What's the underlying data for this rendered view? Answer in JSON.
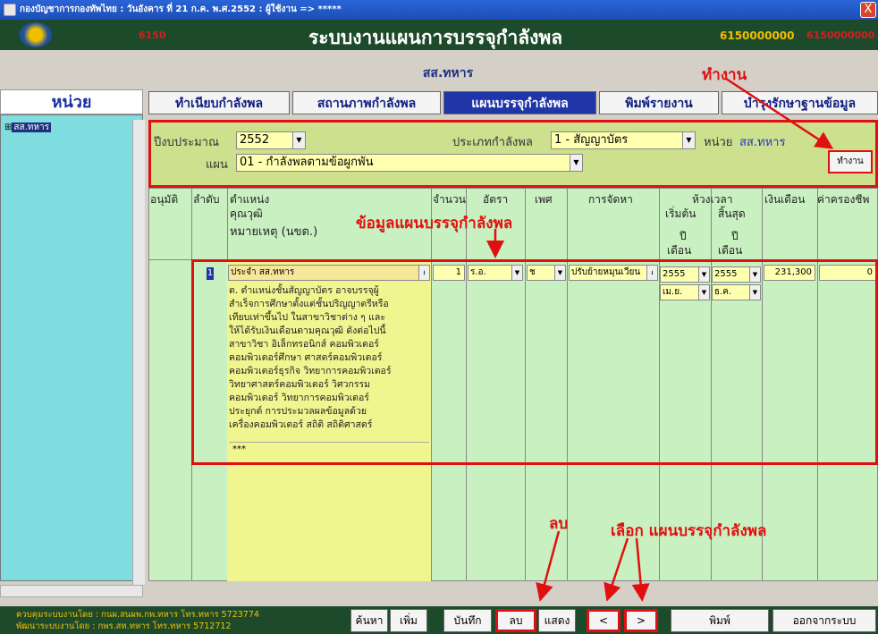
{
  "window": {
    "title": "กองบัญชาการกองทัพไทย : วันอังคาร ที่ 21 ก.ค. พ.ศ.2552 : ผู้ใช้งาน => *****",
    "close_label": "X"
  },
  "banner": {
    "code": "6150",
    "title": "ระบบงานแผนการบรรจุกำลังพล",
    "code1": "6150000000",
    "code2": "6150000000"
  },
  "unit_name": "สส.ทหาร",
  "annotations": {
    "work": "ทำงาน",
    "data": "ข้อมูลแผนบรรจุกำลังพล",
    "delete": "ลบ",
    "select": "เลือก แผนบรรจุกำลังพล"
  },
  "sidebar": {
    "header": "หน่วย",
    "tree_item": "สส.ทหาร"
  },
  "tabs": [
    {
      "label": "ทำเนียบกำลังพล"
    },
    {
      "label": "สถานภาพกำลังพล"
    },
    {
      "label": "แผนบรรจุกำลังพล"
    },
    {
      "label": "พิมพ์รายงาน"
    },
    {
      "label": "บำรุงรักษาฐานข้อมูล"
    }
  ],
  "form": {
    "year_label": "ปีงบประมาณ",
    "year_value": "2552",
    "type_label": "ประเภทกำลังพล",
    "type_value": "1 - สัญญาบัตร",
    "unit_label": "หน่วย",
    "unit_value": "สส.ทหาร",
    "plan_label": "แผน",
    "plan_value": "01 - กำลังพลตามข้อผูกพัน",
    "work_button": "ทำงาน"
  },
  "columns": {
    "approve": "อนุมัติ",
    "order": "ลำดับ",
    "position": "ตำแหน่ง",
    "qualification": "คุณวุฒิ",
    "remark": "หมายเหตุ (นขต.)",
    "count": "จำนวน",
    "rate": "อัตรา",
    "sex": "เพศ",
    "procure": "การจัดหา",
    "period": "ห้วงเวลา",
    "start": "เริ่มต้น",
    "end": "สิ้นสุด",
    "year": "ปี",
    "month": "เดือน",
    "salary": "เงินเดือน",
    "allowance": "ค่าครองชีพ"
  },
  "row": {
    "order": "1",
    "position": "ประจำ สส.ทหาร",
    "count": "1",
    "rate": "ร.อ.",
    "sex": "ช",
    "procure": "ปรับย้ายหมุนเวียน",
    "start_year": "2555",
    "start_month": "เม.ย.",
    "end_year": "2555",
    "end_month": "ธ.ค.",
    "salary": "231,300",
    "allowance": "0",
    "qualification_lines": [
      "ต. ตำแหน่งชั้นสัญญาบัตร อาจบรรจุผู้",
      "สำเร็จการศึกษาตั้งแต่ชั้นปริญญาตรีหรือ",
      "เทียบเท่าขึ้นไป ในสาขาวิชาต่าง ๆ และ",
      "ให้ได้รับเงินเดือนตามคุณวุฒิ ดังต่อไปนี้",
      "  สาขาวิชา อิเล็กทรอนิกส์ คอมพิวเตอร์",
      "คอมพิวเตอร์ศึกษา ศาสตร์คอมพิวเตอร์",
      "คอมพิวเตอร์ธุรกิจ วิทยาการคอมพิวเตอร์",
      "วิทยาศาสตร์คอมพิวเตอร์ วิศวกรรม",
      "คอมพิวเตอร์ วิทยาการคอมพิวเตอร์",
      "ประยุกต์ การประมวลผลข้อมูลด้วย",
      "เครื่องคอมพิวเตอร์ สถิติ สถิติศาสตร์"
    ],
    "remark": "***"
  },
  "footer": {
    "credit1": "ควบคุมระบบงานโดย : กนผ.สนผพ.กพ.ทหาร  โทร.ทหาร  5723774",
    "credit2": "พัฒนาระบบงานโดย : กพร.สท.ทหาร            โทร.ทหาร  5712712",
    "search": "ค้นหา",
    "add": "เพิ่ม",
    "save": "บันทึก",
    "delete": "ลบ",
    "show": "แสดง",
    "prev": "<",
    "next": ">",
    "print": "พิมพ์",
    "exit": "ออกจากระบบ"
  }
}
